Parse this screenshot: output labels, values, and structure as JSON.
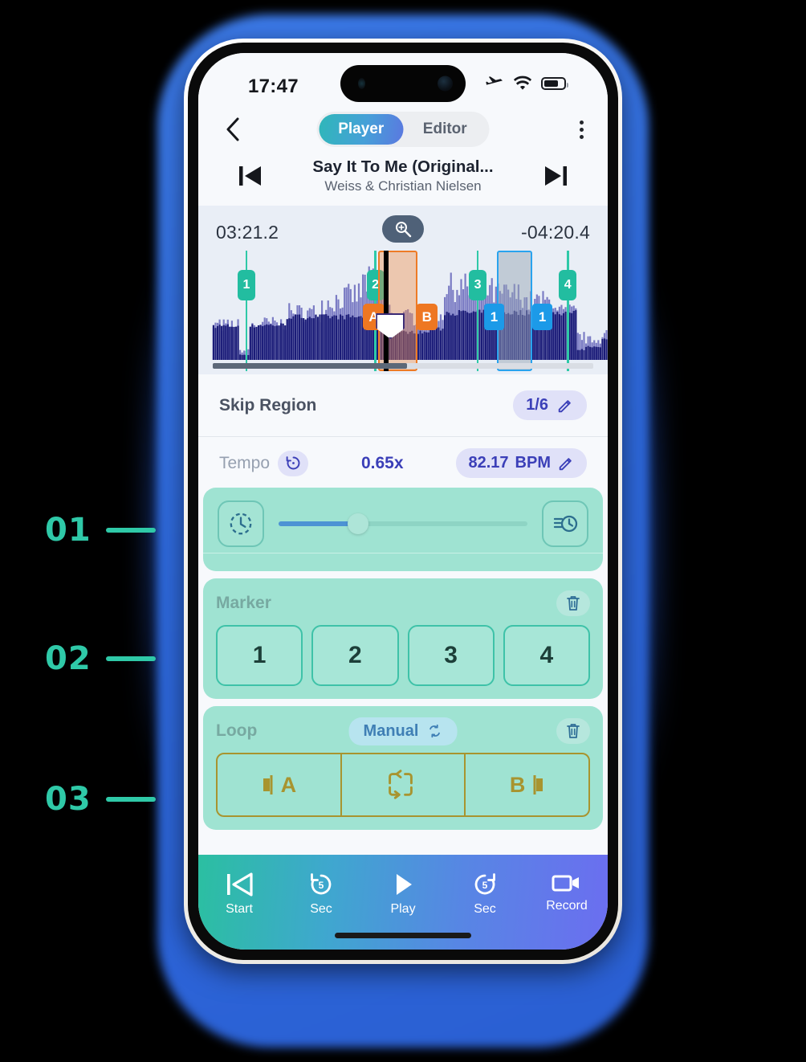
{
  "annotations": [
    {
      "number": "01"
    },
    {
      "number": "02"
    },
    {
      "number": "03"
    }
  ],
  "status_bar": {
    "time": "17:47",
    "icons": [
      "airplane-mode-icon",
      "wifi-icon",
      "battery-icon"
    ]
  },
  "nav": {
    "back_icon": "chevron-left-icon",
    "menu_icon": "kebab-menu-icon",
    "tabs": [
      {
        "label": "Player",
        "active": true
      },
      {
        "label": "Editor",
        "active": false
      }
    ]
  },
  "track": {
    "prev_icon": "skip-previous-icon",
    "next_icon": "skip-next-icon",
    "title": "Say It To Me (Original...",
    "artist": "Weiss & Christian Nielsen"
  },
  "waveform": {
    "elapsed": "03:21.2",
    "remaining": "-04:20.4",
    "zoom_icon": "zoom-in-icon",
    "markers": [
      {
        "label": "1",
        "pos": 11.5
      },
      {
        "label": "2",
        "pos": 43.0
      },
      {
        "label": "3",
        "pos": 68.0
      },
      {
        "label": "4",
        "pos": 90.0
      }
    ],
    "ab_region": {
      "start": 44.0,
      "width": 9.5,
      "a_label": "A",
      "b_label": "B"
    },
    "loop_region": {
      "start": 73.0,
      "width": 8.5,
      "left_label": "1",
      "right_label": "1"
    },
    "playhead": {
      "pos": 45.3
    },
    "progress_percent": 51
  },
  "skip_region": {
    "label": "Skip Region",
    "value": "1/6",
    "edit_icon": "pencil-icon"
  },
  "tempo": {
    "label": "Tempo",
    "reset_icon": "reset-clock-icon",
    "value": "0.65x",
    "bpm_value": "82.17",
    "bpm_unit": "BPM",
    "bpm_edit_icon": "pencil-icon",
    "left_icon": "dashed-clock-icon",
    "right_icon": "clock-list-icon",
    "slider_percent": 32
  },
  "marker": {
    "title": "Marker",
    "delete_icon": "trash-icon",
    "buttons": [
      "1",
      "2",
      "3",
      "4"
    ]
  },
  "loop": {
    "title": "Loop",
    "mode_label": "Manual",
    "mode_icon": "loop-toggle-icon",
    "delete_icon": "trash-icon",
    "cells": [
      {
        "label": "A",
        "icon": "loop-start-icon"
      },
      {
        "label": "",
        "icon": "loop-repeat-icon"
      },
      {
        "label": "B",
        "icon": "loop-end-icon"
      }
    ]
  },
  "bottom_bar": {
    "items": [
      {
        "label": "Start",
        "icon": "skip-to-start-icon"
      },
      {
        "label": "Sec",
        "icon": "rewind-5-sec-icon"
      },
      {
        "label": "Play",
        "icon": "play-icon"
      },
      {
        "label": "Sec",
        "icon": "forward-5-sec-icon"
      },
      {
        "label": "Record",
        "icon": "record-video-icon"
      }
    ]
  },
  "colors": {
    "accent_teal": "#2fc9a8",
    "panel_green": "#9fe3d2",
    "indigo": "#3b3fb8",
    "orange": "#ee7722",
    "blue": "#1c9ae8",
    "waveform_dark": "#1b1c78",
    "waveform_light": "#7b7cc4"
  }
}
